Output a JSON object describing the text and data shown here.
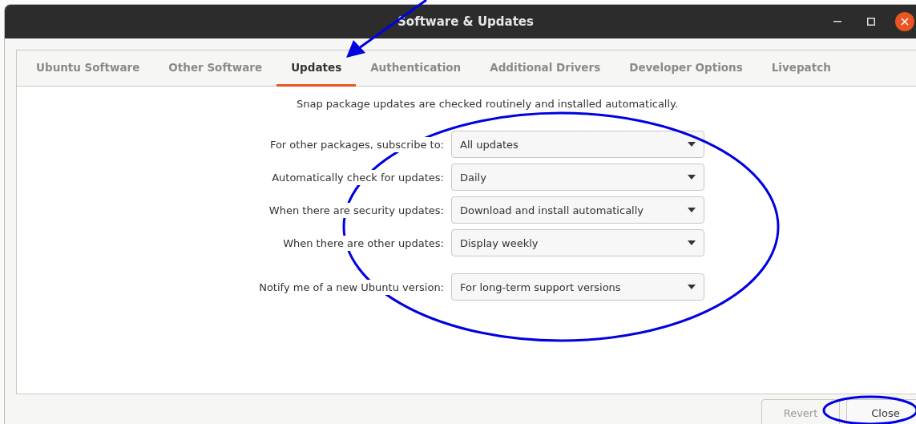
{
  "window": {
    "title": "Software & Updates"
  },
  "tabs": [
    {
      "label": "Ubuntu Software",
      "selected": false
    },
    {
      "label": "Other Software",
      "selected": false
    },
    {
      "label": "Updates",
      "selected": true
    },
    {
      "label": "Authentication",
      "selected": false
    },
    {
      "label": "Additional Drivers",
      "selected": false
    },
    {
      "label": "Developer Options",
      "selected": false
    },
    {
      "label": "Livepatch",
      "selected": false
    }
  ],
  "info": "Snap package updates are checked routinely and installed automatically.",
  "settings": [
    {
      "label": "For other packages, subscribe to:",
      "value": "All updates"
    },
    {
      "label": "Automatically check for updates:",
      "value": "Daily"
    },
    {
      "label": "When there are security updates:",
      "value": "Download and install automatically"
    },
    {
      "label": "When there are other updates:",
      "value": "Display weekly"
    }
  ],
  "release_upgrade": {
    "label": "Notify me of a new Ubuntu version:",
    "value": "For long-term support versions"
  },
  "buttons": [
    {
      "label": "Revert",
      "disabled": true
    },
    {
      "label": "Close",
      "disabled": false
    }
  ]
}
